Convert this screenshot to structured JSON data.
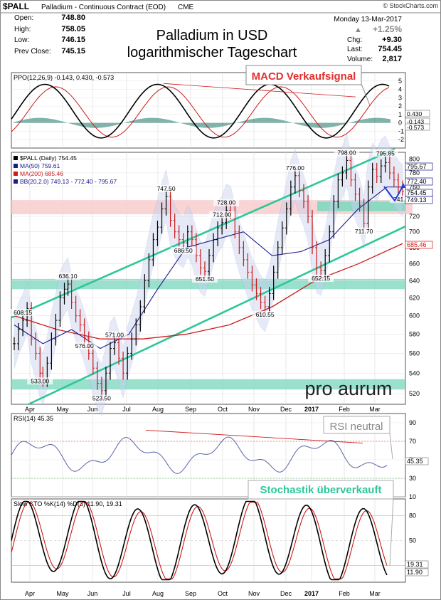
{
  "chart_data": [
    {
      "type": "line",
      "panel": "price",
      "log_scale": true,
      "symbol": "$PALL",
      "header_name": "Palladium - Continuous Contract (EOD)",
      "header_exchange": "CME",
      "source": "© StockCharts.com",
      "date": "Monday 13-Mar-2017",
      "change_pct": "+1.25%",
      "ohlc": {
        "open_label": "Open:",
        "open": "748.80",
        "high_label": "High:",
        "high": "758.05",
        "low_label": "Low:",
        "low": "746.15",
        "prev_label": "Prev Close:",
        "prev": "745.15",
        "chg_label": "Chg:",
        "chg": "+9.30",
        "last_label": "Last:",
        "last": "754.45",
        "vol_label": "Volume:",
        "vol": "2,817"
      },
      "title_line1": "Palladium in USD",
      "title_line2": "logarithmischer Tageschart",
      "legend": [
        {
          "label": "$PALL (Daily) 754.45",
          "color": "#000000"
        },
        {
          "label": "MA(50) 759.61",
          "color": "#1a1a8c"
        },
        {
          "label": "MA(200) 685.46",
          "color": "#cc1a1a"
        },
        {
          "label": "BB(20,2.0) 749.13 - 772.40 - 795.67",
          "color": "#1a1a8c"
        }
      ],
      "ylim": [
        510,
        810
      ],
      "yticks": [
        520,
        540,
        560,
        580,
        600,
        620,
        640,
        660,
        680,
        700,
        720,
        740,
        760,
        780,
        800
      ],
      "x_months": [
        "Apr",
        "May",
        "Jun",
        "Jul",
        "Aug",
        "Sep",
        "Oct",
        "Nov",
        "Dec",
        "2017",
        "Feb",
        "Mar"
      ],
      "series": [
        {
          "name": "$PALL",
          "x": [
            0,
            6,
            12,
            18,
            24,
            30,
            36,
            40,
            46,
            52,
            58,
            64,
            70,
            75,
            80,
            86,
            92,
            98,
            104,
            110,
            116,
            122,
            128,
            134,
            140,
            146,
            152,
            158,
            164,
            170,
            176,
            182,
            188,
            194,
            200,
            206,
            212,
            218,
            224,
            230,
            236,
            242,
            248,
            254,
            260,
            266,
            272,
            278,
            284,
            290,
            296,
            302,
            308,
            314,
            320,
            326,
            332,
            338,
            344,
            350,
            356,
            362,
            368,
            374,
            380,
            386,
            392,
            398,
            404,
            410,
            416,
            422,
            428,
            434,
            440,
            446,
            452,
            458,
            464,
            470,
            476,
            482,
            488,
            494,
            500,
            506,
            512,
            518,
            524,
            530,
            536,
            542
          ],
          "values": [
            570,
            585,
            595,
            608,
            575,
            560,
            540,
            533,
            550,
            575,
            595,
            620,
            630,
            636,
            615,
            600,
            590,
            576,
            560,
            545,
            530,
            523,
            540,
            565,
            571,
            555,
            540,
            560,
            575,
            590,
            610,
            640,
            665,
            690,
            706,
            730,
            747,
            715,
            700,
            690,
            686,
            700,
            690,
            670,
            655,
            651,
            670,
            690,
            705,
            712,
            728,
            725,
            700,
            680,
            665,
            650,
            635,
            625,
            615,
            610,
            625,
            650,
            680,
            705,
            730,
            760,
            776,
            755,
            740,
            720,
            680,
            655,
            652,
            670,
            700,
            740,
            770,
            780,
            798,
            770,
            750,
            735,
            711,
            760,
            785,
            775,
            790,
            795,
            780,
            770,
            760,
            754
          ]
        },
        {
          "name": "MA(50)",
          "x": [
            0,
            40,
            80,
            120,
            160,
            200,
            240,
            280,
            320,
            360,
            400,
            440,
            480,
            520,
            542
          ],
          "values": [
            590,
            570,
            585,
            565,
            580,
            630,
            680,
            690,
            700,
            670,
            675,
            690,
            730,
            760,
            760
          ]
        },
        {
          "name": "MA(200)",
          "x": [
            0,
            60,
            120,
            180,
            240,
            300,
            360,
            420,
            480,
            542
          ],
          "values": [
            600,
            585,
            575,
            575,
            580,
            590,
            610,
            640,
            660,
            685
          ]
        }
      ],
      "annotations": [
        "608.15",
        "533.00",
        "636.10",
        "576.00",
        "571.00",
        "523.50",
        "747.50",
        "686.50",
        "712.00",
        "728.00",
        "651.50",
        "610.55",
        "776.00",
        "652.15",
        "798.00",
        "795.85",
        "711.70",
        "741.80"
      ],
      "right_labels": [
        "795.67",
        "772.40",
        "754.45",
        "749.13",
        "685.46"
      ],
      "brand": "pro aurum"
    },
    {
      "type": "line",
      "panel": "ppo",
      "label": "PPO(12,26,9) -0.143, 0.430, -0.573",
      "ylim": [
        -3,
        6
      ],
      "yticks": [
        -2,
        -1,
        0,
        1,
        2,
        3,
        4,
        5
      ],
      "right_labels": [
        "0.430",
        "-0.143",
        "-0.573"
      ],
      "callout": "MACD Verkaufsignal"
    },
    {
      "type": "line",
      "panel": "rsi",
      "label": "RSI(14) 45.35",
      "ylim": [
        10,
        100
      ],
      "yticks": [
        10,
        30,
        50,
        70,
        90
      ],
      "right_labels": [
        "45.35"
      ],
      "callout": "RSI neutral"
    },
    {
      "type": "line",
      "panel": "sto",
      "label": "Slow STO %K(14) %D(3) 11.90, 19.31",
      "ylim": [
        0,
        100
      ],
      "yticks": [
        20,
        50,
        80
      ],
      "right_labels": [
        "19.31",
        "11.90"
      ],
      "callout": "Stochastik überverkauft"
    }
  ]
}
